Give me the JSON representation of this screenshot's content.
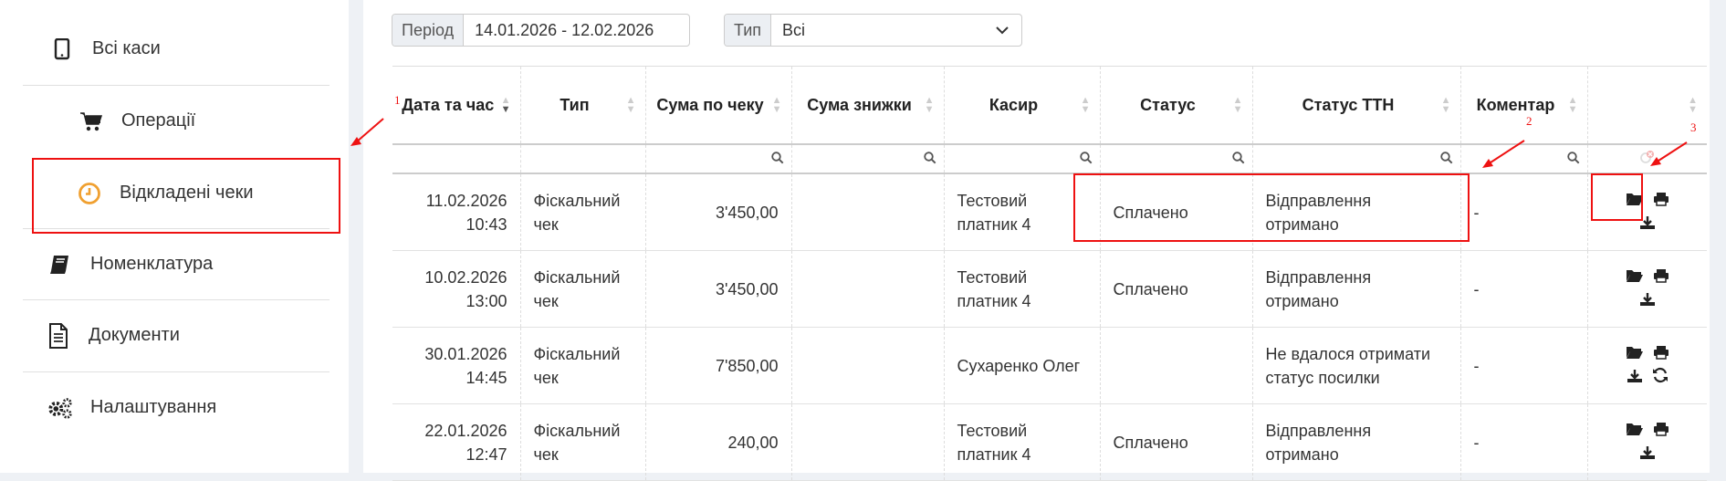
{
  "sidebar": {
    "items": [
      {
        "label": "Всі каси",
        "icon": "tablet-icon"
      },
      {
        "label": "Операції",
        "icon": "cart-icon"
      },
      {
        "label": "Відкладені чеки",
        "icon": "clock-icon"
      },
      {
        "label": "Номенклатура",
        "icon": "book-icon"
      },
      {
        "label": "Документи",
        "icon": "document-icon"
      },
      {
        "label": "Налаштування",
        "icon": "gears-icon"
      }
    ]
  },
  "filters": {
    "period_label": "Період",
    "period_value": "14.01.2026 - 12.02.2026",
    "type_label": "Тип",
    "type_value": "Всі"
  },
  "table": {
    "headers": [
      "Дата та час",
      "Тип",
      "Сума по чеку",
      "Сума знижки",
      "Касир",
      "Статус",
      "Статус ТТН",
      "Коментар",
      ""
    ],
    "rows": [
      {
        "date": "11.02.2026",
        "time": "10:43",
        "type": "Фіскальний чек",
        "sum": "3'450,00",
        "discount": "",
        "cashier": "Тестовий платник 4",
        "status": "Сплачено",
        "ttn": "Відправлення отримано",
        "comment": "-",
        "refresh": false
      },
      {
        "date": "10.02.2026",
        "time": "13:00",
        "type": "Фіскальний чек",
        "sum": "3'450,00",
        "discount": "",
        "cashier": "Тестовий платник 4",
        "status": "Сплачено",
        "ttn": "Відправлення отримано",
        "comment": "-",
        "refresh": false
      },
      {
        "date": "30.01.2026",
        "time": "14:45",
        "type": "Фіскальний чек",
        "sum": "7'850,00",
        "discount": "",
        "cashier": "Сухаренко Олег",
        "status": "",
        "ttn": "Не вдалося отримати статус посилки",
        "comment": "-",
        "refresh": true
      },
      {
        "date": "22.01.2026",
        "time": "12:47",
        "type": "Фіскальний чек",
        "sum": "240,00",
        "discount": "",
        "cashier": "Тестовий платник 4",
        "status": "Сплачено",
        "ttn": "Відправлення отримано",
        "comment": "-",
        "refresh": false
      }
    ]
  },
  "annotations": [
    "1",
    "2",
    "3"
  ],
  "colors": {
    "highlight": "#ee1111",
    "clock_accent": "#f0a030"
  }
}
